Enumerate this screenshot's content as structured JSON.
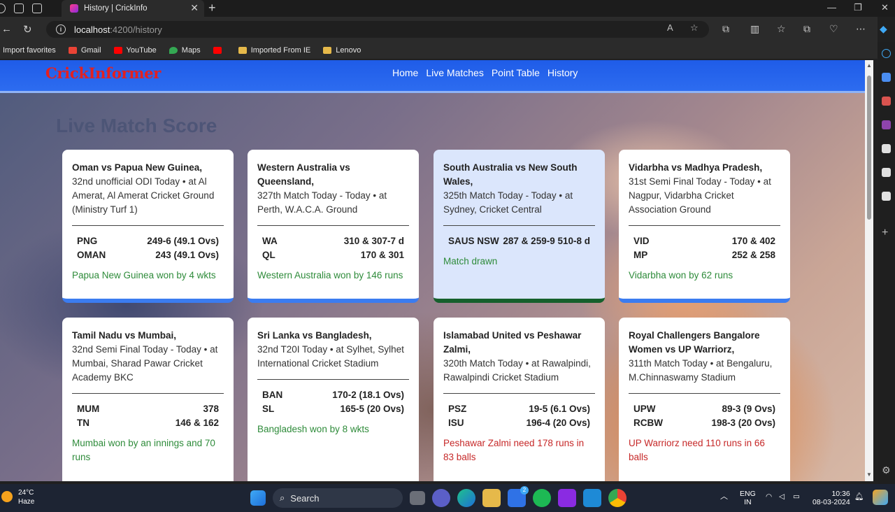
{
  "browser": {
    "tab_title": "History | CrickInfo",
    "url_host": "localhost",
    "url_path": ":4200/history",
    "favorites": [
      "Import favorites",
      "Gmail",
      "YouTube",
      "Maps",
      "",
      "Imported From IE",
      "Lenovo"
    ]
  },
  "site": {
    "logo": "CrickInformer",
    "nav": [
      "Home",
      "Live Matches",
      "Point Table",
      "History"
    ],
    "heading": "Live Match Score"
  },
  "matches": [
    {
      "title": "Oman vs Papua New Guinea,",
      "desc": "32nd unofficial ODI Today • at Al Amerat, Al Amerat Cricket Ground (Ministry Turf 1)",
      "team1": "PNG",
      "score1": "249-6 (49.1 Ovs)",
      "team2": "OMAN",
      "score2": "243 (49.1 Ovs)",
      "result": "Papua New Guinea won by 4 wkts"
    },
    {
      "title": "Western Australia vs Queensland,",
      "desc": "327th Match Today - Today • at Perth, W.A.C.A. Ground",
      "team1": "WA",
      "score1": "310 & 307-7 d",
      "team2": "QL",
      "score2": "170 & 301",
      "result": "Western Australia won by 146 runs"
    },
    {
      "title": "South Australia vs New South Wales,",
      "desc": "325th Match Today - Today • at Sydney, Cricket Central",
      "team1": "SAUS NSW",
      "score1": "287 & 259-9 510-8 d",
      "result": "Match drawn"
    },
    {
      "title": "Vidarbha vs Madhya Pradesh,",
      "desc": "31st Semi Final Today - Today • at Nagpur, Vidarbha Cricket Association Ground",
      "team1": "VID",
      "score1": "170 & 402",
      "team2": "MP",
      "score2": "252 & 258",
      "result": "Vidarbha won by 62 runs"
    },
    {
      "title": "Tamil Nadu vs Mumbai,",
      "desc": "32nd Semi Final Today - Today • at Mumbai, Sharad Pawar Cricket Academy BKC",
      "team1": "MUM",
      "score1": "378",
      "team2": "TN",
      "score2": "146 & 162",
      "result": "Mumbai won by an innings and 70 runs"
    },
    {
      "title": "Sri Lanka vs Bangladesh,",
      "desc": "32nd T20I Today • at Sylhet, Sylhet International Cricket Stadium",
      "team1": "BAN",
      "score1": "170-2 (18.1 Ovs)",
      "team2": "SL",
      "score2": "165-5 (20 Ovs)",
      "result": "Bangladesh won by 8 wkts"
    },
    {
      "title": "Islamabad United vs Peshawar Zalmi,",
      "desc": "320th Match Today • at Rawalpindi, Rawalpindi Cricket Stadium",
      "team1": "PSZ",
      "score1": "19-5 (6.1 Ovs)",
      "team2": "ISU",
      "score2": "196-4 (20 Ovs)",
      "result": "Peshawar Zalmi need 178 runs in 83 balls"
    },
    {
      "title": "Royal Challengers Bangalore Women vs UP Warriorz,",
      "desc": "311th Match Today • at Bengaluru, M.Chinnaswamy Stadium",
      "team1": "UPW",
      "score1": "89-3 (9 Ovs)",
      "team2": "RCBW",
      "score2": "198-3 (20 Ovs)",
      "result": "UP Warriorz need 110 runs in 66 balls"
    }
  ],
  "taskbar": {
    "temp": "24°C",
    "weather": "Haze",
    "search": "Search",
    "lang1": "ENG",
    "lang2": "IN",
    "time": "10:36",
    "date": "08-03-2024",
    "badge": "2"
  },
  "colors": {
    "nav_blue": "#1f5ce8",
    "logo_red": "#e32020",
    "won_green": "#2e8b3a",
    "need_red": "#c62828",
    "drawn_bg": "#dbe6fc"
  }
}
